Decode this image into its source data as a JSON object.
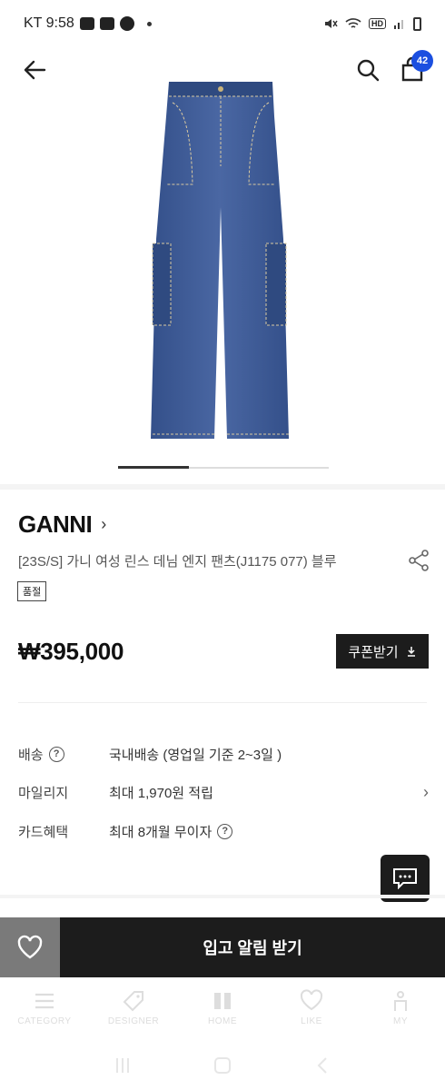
{
  "status_bar": {
    "carrier_time": "KT 9:58",
    "hd": "HD"
  },
  "header": {
    "cart_count": "42"
  },
  "product": {
    "brand": "GANNI",
    "brand_chevron": "›",
    "name": "[23S/S] 가니 여성 린스 데님 엔지 팬츠(J1175 077) 블루",
    "soldout_badge": "품절",
    "price": "₩395,000",
    "coupon_label": "쿠폰받기",
    "image_color": "#3f5a93"
  },
  "info": {
    "shipping_label": "배송",
    "shipping_value": "국내배송 (영업일 기준 2~3일 )",
    "mileage_label": "마일리지",
    "mileage_value": "최대 1,970원 적립",
    "card_label": "카드혜택",
    "card_value": "최대 8개월 무이자",
    "help_icon_glyph": "?",
    "chevron_glyph": "›"
  },
  "action_bar": {
    "notify_label": "입고 알림 받기"
  },
  "tabbar": {
    "tabs": [
      {
        "label": "CATEGORY",
        "icon": "menu-icon"
      },
      {
        "label": "DESIGNER",
        "icon": "tag-icon"
      },
      {
        "label": "HOME",
        "icon": "home-icon"
      },
      {
        "label": "LIKE",
        "icon": "heart-icon"
      },
      {
        "label": "MY",
        "icon": "person-icon"
      }
    ]
  },
  "colors": {
    "accent_badge": "#1b4fe0",
    "dark_button": "#1c1c1c",
    "wish_button": "#7a7a7a"
  }
}
